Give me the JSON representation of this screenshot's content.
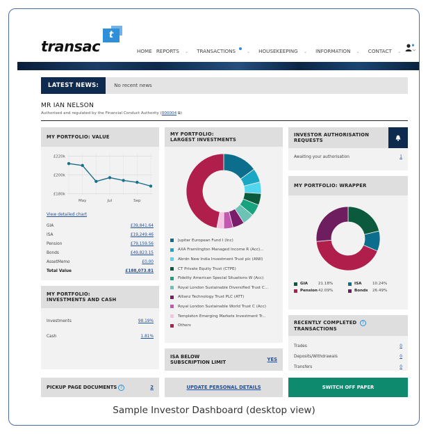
{
  "header": {
    "logo_text": "transac",
    "logo_mark": "t",
    "nav": [
      "HOME",
      "REPORTS",
      "TRANSACTIONS",
      "HOUSEKEEPING",
      "INFORMATION",
      "CONTACT"
    ],
    "user_icon": "user-icon"
  },
  "news": {
    "tag": "LATEST NEWS:",
    "text": "No recent news"
  },
  "client": {
    "name": "MR IAN NELSON",
    "authorised": "Authorised and regulated by the Financial Conduct Authority",
    "fca_ref": "000004"
  },
  "value_panel": {
    "title": "MY PORTFOLIO: VALUE",
    "link": "View detailed chart",
    "rows": [
      {
        "label": "GIA",
        "value": "£39,841.64"
      },
      {
        "label": "ISA",
        "value": "£19,249.46"
      },
      {
        "label": "Pension",
        "value": "£79,159.56"
      },
      {
        "label": "Bonds",
        "value": "£49,823.15"
      },
      {
        "label": "AssetMemo",
        "value": "£0.00"
      },
      {
        "label": "Total Value",
        "value": "£188,073.81"
      }
    ]
  },
  "investments_panel": {
    "title_1": "MY PORTFOLIO:",
    "title_2": "INVESTMENTS AND CASH",
    "rows": [
      {
        "label": "Investments",
        "value": "98.19%"
      },
      {
        "label": "Cash",
        "value": "1.81%"
      }
    ]
  },
  "pickup": {
    "label": "PICKUP PAGE DOCUMENTS",
    "count": "2"
  },
  "largest_panel": {
    "title_1": "MY PORTFOLIO:",
    "title_2": "LARGEST INVESTMENTS",
    "legend": [
      "Jupiter European Fund I (Inc)",
      "AXA Framlington Managed Income R (Acc)...",
      "Abrdn New India Investment Trust plc (ANII)",
      "CT Private Equity Trust (CTPE)",
      "Fidelity American Special Situations W (Acc)",
      "Royal London Sustainable Diversified Trust C...",
      "Allianz Technology Trust PLC (ATT)",
      "Royal London Sustainable World Trust C (Acc)",
      "Templeton Emerging Markets Investment Tr...",
      "Others"
    ]
  },
  "isa_panel": {
    "title_1": "ISA BELOW",
    "title_2": "SUBSCRIPTION LIMIT",
    "value": "YES"
  },
  "update_button": {
    "label": "UPDATE PERSONAL DETAILS"
  },
  "auth_panel": {
    "title_1": "INVESTOR AUTHORISATION",
    "title_2": "REQUESTS",
    "row_label": "Awaiting your authorisation",
    "row_value": "1"
  },
  "wrapper_panel": {
    "title": "MY PORTFOLIO: WRAPPER",
    "legend": [
      {
        "label": "GIA",
        "pct": "21.18%"
      },
      {
        "label": "ISA",
        "pct": "10.24%"
      },
      {
        "label": "Pension",
        "pct": "42.09%"
      },
      {
        "label": "Bonds",
        "pct": "26.49%"
      }
    ]
  },
  "recent_panel": {
    "title_1": "RECENTLY COMPLETED",
    "title_2": "TRANSACTIONS",
    "rows": [
      {
        "label": "Trades",
        "value": "0"
      },
      {
        "label": "Deposits/Withdrawals",
        "value": "0"
      },
      {
        "label": "Transfers",
        "value": "0"
      }
    ]
  },
  "switch_button": {
    "label": "SWITCH OFF PAPER"
  },
  "caption": "Sample Investor Dashboard (desktop view)",
  "colors": {
    "navy": "#0f2a4f",
    "teal_button": "#0e8a6e",
    "link": "#1f4e9c",
    "line": "#1a6f8a",
    "largest": [
      "#0c6e8c",
      "#19a7c4",
      "#52d6ee",
      "#0b5a3e",
      "#18a37e",
      "#6cc2b5",
      "#7a1e6a",
      "#c458b0",
      "#f4c4e2",
      "#b01e4c"
    ],
    "wrapper": [
      "#0b5a3e",
      "#0c6e8c",
      "#b01e4c",
      "#6e1d5e"
    ]
  },
  "chart_data": [
    {
      "type": "line",
      "title": "",
      "x": [
        "Apr",
        "May",
        "Jun",
        "Jul",
        "Aug",
        "Sep",
        "Oct"
      ],
      "tick_labels_x": [
        "May",
        "Jul",
        "Sep"
      ],
      "values": [
        212,
        210,
        193,
        197,
        194,
        192,
        188
      ],
      "y_ticks": [
        "£220k",
        "£200k",
        "£180k"
      ],
      "ylim": [
        178,
        224
      ],
      "grid": true
    },
    {
      "type": "pie",
      "title": "",
      "labels": [
        "Jupiter European Fund I (Inc)",
        "AXA Framlington Managed Income R (Acc)...",
        "Abrdn New India Investment Trust plc (ANII)",
        "CT Private Equity Trust (CTPE)",
        "Fidelity American Special Situations W (Acc)",
        "Royal London Sustainable Diversified Trust C...",
        "Allianz Technology Trust PLC (ATT)",
        "Royal London Sustainable World Trust C (Acc)",
        "Templeton Emerging Markets Investment Tr...",
        "Others"
      ],
      "values": [
        15,
        6,
        5,
        5,
        5,
        5,
        5,
        4,
        3,
        47
      ]
    },
    {
      "type": "pie",
      "title": "",
      "labels": [
        "GIA",
        "ISA",
        "Pension",
        "Bonds"
      ],
      "values": [
        21.18,
        10.24,
        42.09,
        26.49
      ]
    }
  ]
}
